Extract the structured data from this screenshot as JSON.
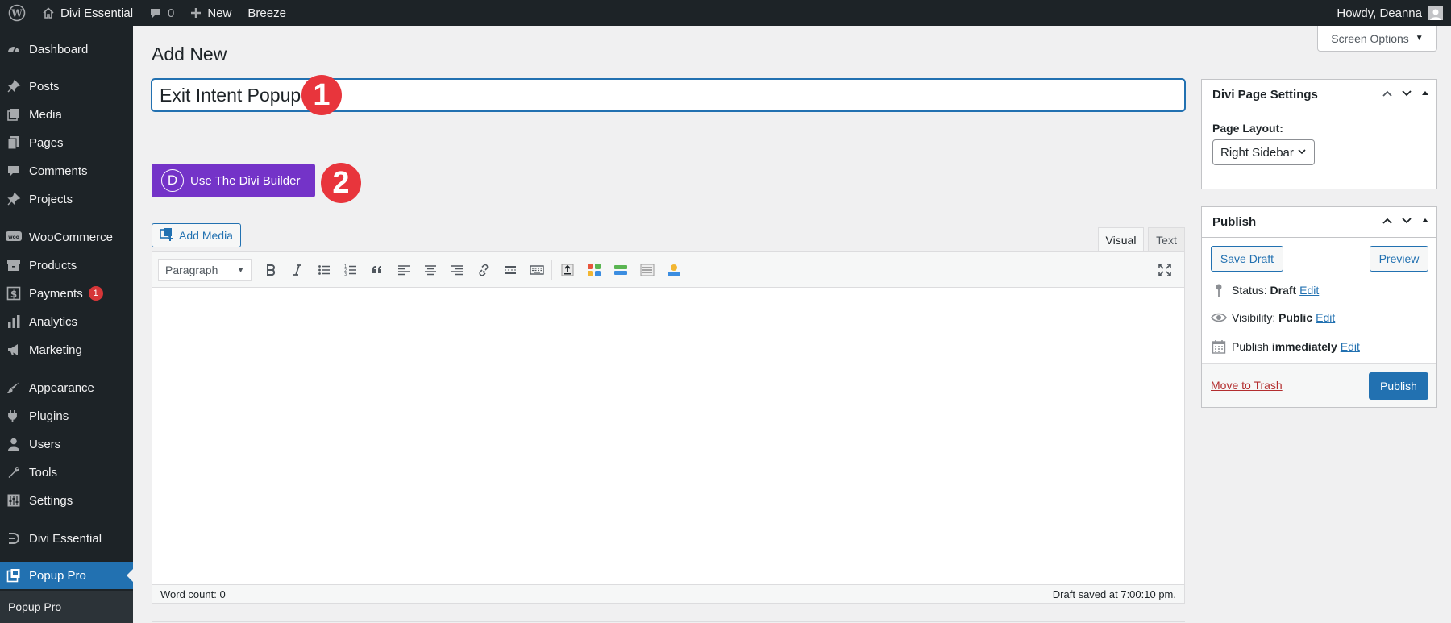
{
  "adminbar": {
    "site_name": "Divi Essential",
    "comments_count": "0",
    "new_label": "New",
    "breeze_label": "Breeze",
    "howdy": "Howdy, Deanna"
  },
  "sidebar": {
    "items": [
      {
        "label": "Dashboard",
        "icon": "dashboard-icon"
      },
      {
        "label": "Posts",
        "icon": "pin-icon"
      },
      {
        "label": "Media",
        "icon": "media-icon"
      },
      {
        "label": "Pages",
        "icon": "pages-icon"
      },
      {
        "label": "Comments",
        "icon": "comment-icon"
      },
      {
        "label": "Projects",
        "icon": "pin-icon"
      },
      {
        "label": "WooCommerce",
        "icon": "woo-icon"
      },
      {
        "label": "Products",
        "icon": "archive-icon"
      },
      {
        "label": "Payments",
        "icon": "dollar-icon",
        "badge": "1"
      },
      {
        "label": "Analytics",
        "icon": "bar-chart-icon"
      },
      {
        "label": "Marketing",
        "icon": "megaphone-icon"
      },
      {
        "label": "Appearance",
        "icon": "brush-icon"
      },
      {
        "label": "Plugins",
        "icon": "plugin-icon"
      },
      {
        "label": "Users",
        "icon": "user-icon"
      },
      {
        "label": "Tools",
        "icon": "wrench-icon"
      },
      {
        "label": "Settings",
        "icon": "settings-icon"
      },
      {
        "label": "Divi Essential",
        "icon": "divi-essential-icon"
      },
      {
        "label": "Popup Pro",
        "icon": "popup-icon"
      }
    ],
    "submenu_label": "Popup Pro"
  },
  "main": {
    "page_title": "Add New",
    "screen_options": "Screen Options",
    "title_value": "Exit Intent Popup",
    "step1": "1",
    "step2": "2",
    "divi_button": "Use The Divi Builder",
    "divi_logo": "D",
    "add_media": "Add Media",
    "tab_visual": "Visual",
    "tab_text": "Text",
    "format_select": "Paragraph",
    "word_count": "Word count: 0",
    "draft_saved": "Draft saved at 7:00:10 pm."
  },
  "divi_settings": {
    "title": "Divi Page Settings",
    "layout_label": "Page Layout:",
    "layout_value": "Right Sidebar"
  },
  "publish": {
    "title": "Publish",
    "save_draft": "Save Draft",
    "preview": "Preview",
    "status_label": "Status:",
    "status_value": "Draft",
    "visibility_label": "Visibility:",
    "visibility_value": "Public",
    "publish_label": "Publish",
    "publish_value": "immediately",
    "edit": "Edit",
    "move_to_trash": "Move to Trash",
    "publish_button": "Publish"
  },
  "colors": {
    "admin_dark": "#1d2327",
    "accent_blue": "#2271b1",
    "divi_purple": "#7433c8",
    "step_red": "#e8353c",
    "badge_red": "#d63638"
  }
}
